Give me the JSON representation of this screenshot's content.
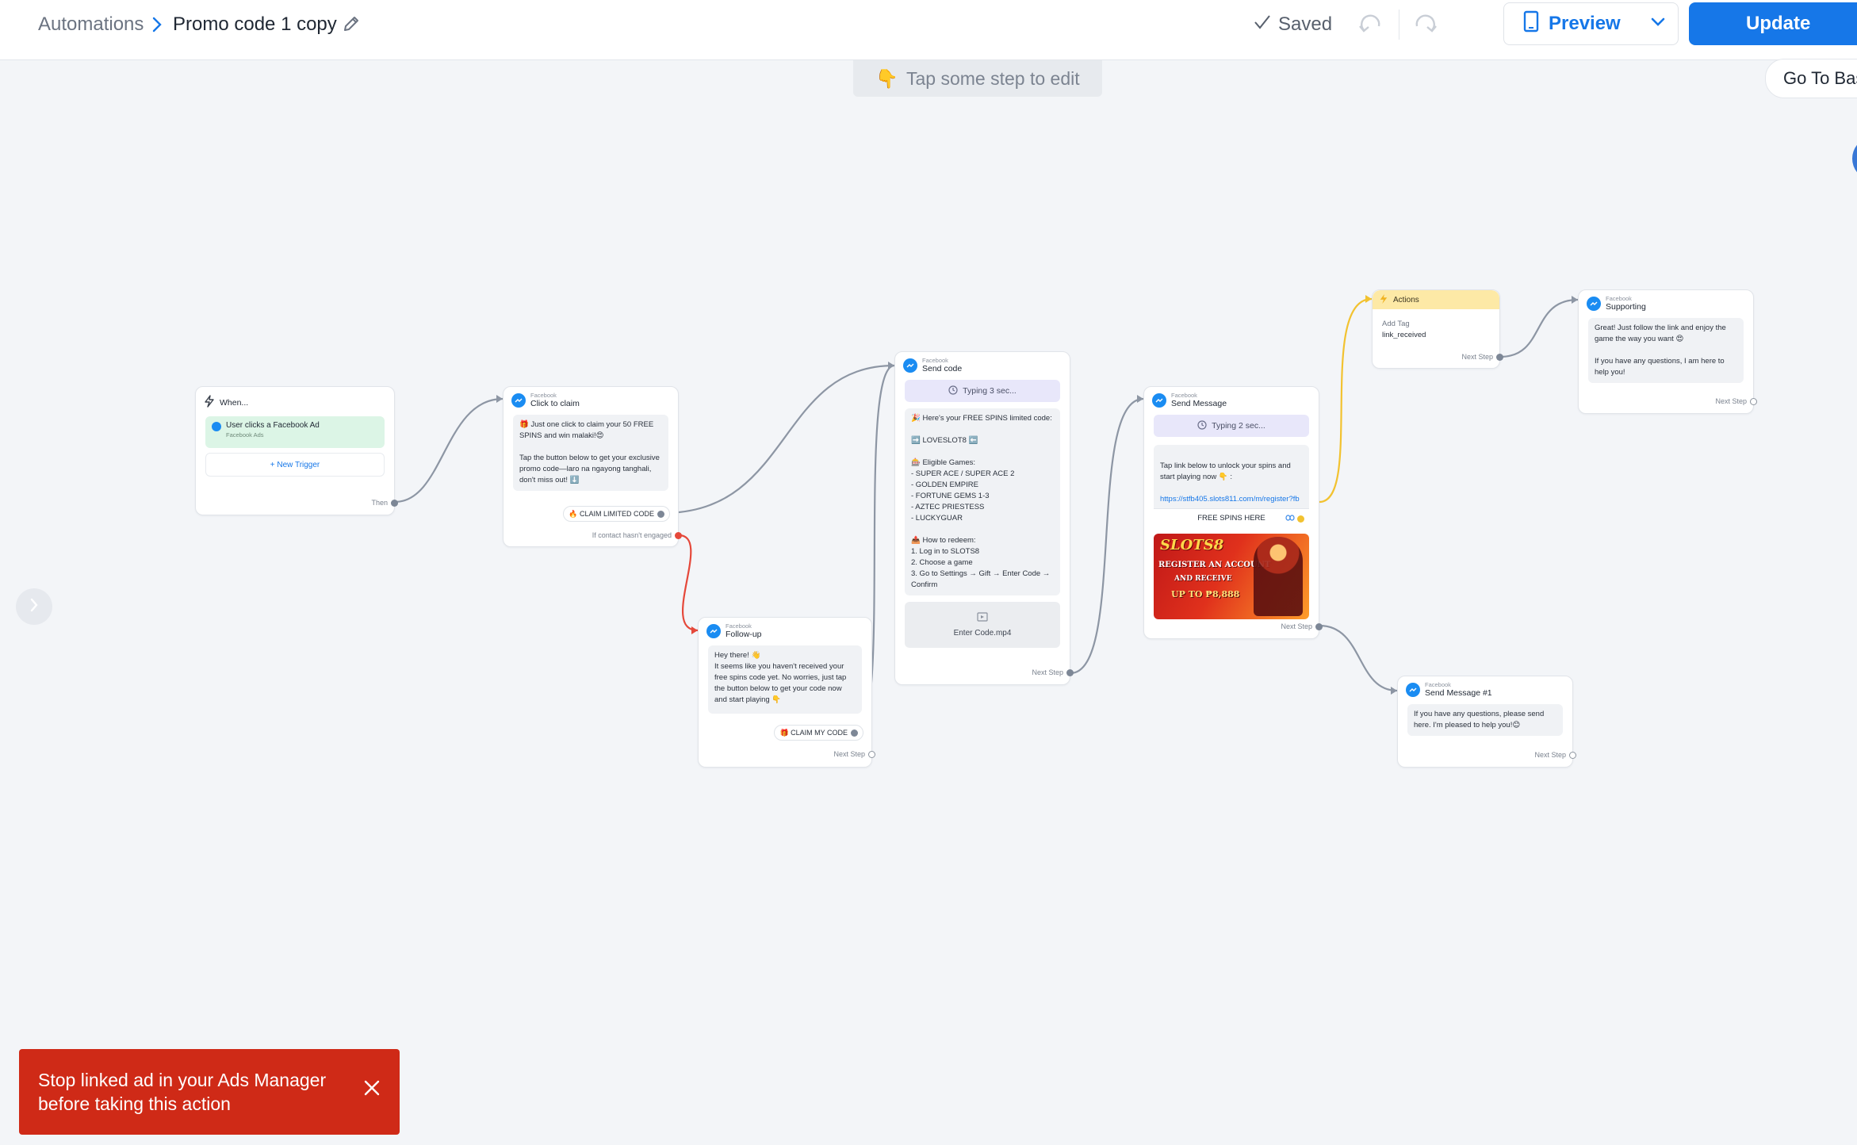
{
  "header": {
    "breadcrumb_root": "Automations",
    "breadcrumb_current": "Promo code 1 copy",
    "saved_label": "Saved",
    "preview_label": "Preview",
    "update_label": "Update"
  },
  "canvas": {
    "hint": "Tap some step to edit",
    "hint_icon": "pointing-down-emoji",
    "go_to_basic_label": "Go To Basic"
  },
  "nodes": {
    "trigger": {
      "title": "When...",
      "trigger_label": "User clicks a Facebook Ad",
      "trigger_source": "Facebook Ads",
      "new_trigger": "+ New Trigger",
      "footer": "Then"
    },
    "click_to_claim": {
      "channel": "Facebook",
      "title": "Click to claim",
      "message": "🎁 Just one click to claim your 50 FREE SPINS and win malaki!😍\n\nTap the button below to get your exclusive promo code—laro na ngayong tanghali, don't miss out! ⬇️",
      "button": "🔥 CLAIM LIMITED CODE",
      "footer": "If contact hasn't engaged"
    },
    "follow_up": {
      "channel": "Facebook",
      "title": "Follow-up",
      "message": "Hey there! 👋\nIt seems like you haven't received your free spins code yet. No worries, just tap the button below to get your code now and start playing 👇",
      "button": "🎁 CLAIM MY CODE",
      "footer": "Next Step"
    },
    "send_code": {
      "channel": "Facebook",
      "title": "Send code",
      "typing": "Typing 3 sec...",
      "message": "🎉 Here's your FREE SPINS limited code:\n\n➡️ LOVESLOT8 ⬅️\n\n🎰 Eligible Games:\n- SUPER ACE / SUPER ACE 2\n- GOLDEN EMPIRE\n- FORTUNE GEMS 1-3\n- AZTEC PRIESTESS\n- LUCKYGUAR\n\n📤 How to redeem:\n1. Log in to SLOTS8\n2. Choose a game\n3. Go to Settings → Gift → Enter Code → Confirm",
      "video": "Enter Code.mp4",
      "footer": "Next Step"
    },
    "send_message": {
      "channel": "Facebook",
      "title": "Send Message",
      "typing": "Typing 2 sec...",
      "message": "Tap link below to unlock your spins and start playing now 👇 :",
      "link": "https://stfb405.slots811.com/m/register?fb",
      "button": "FREE SPINS HERE",
      "banner_brand": "SLOTS8",
      "banner_line1": "REGISTER AN ACCOUNT",
      "banner_line2": "AND RECEIVE",
      "banner_line3": "UP TO ₱8,888",
      "footer": "Next Step"
    },
    "actions": {
      "title": "Actions",
      "label": "Add Tag",
      "value": "link_received",
      "footer": "Next Step"
    },
    "supporting": {
      "channel": "Facebook",
      "title": "Supporting",
      "message": "Great! Just follow the link and enjoy the game the way you want 😍\n\nIf you have any questions, I am here to help you!",
      "footer": "Next Step"
    },
    "send_message_1": {
      "channel": "Facebook",
      "title": "Send Message #1",
      "message": "If you have any questions, please send here. I'm pleased to help you!😊",
      "footer": "Next Step"
    }
  },
  "toast": {
    "message": "Stop linked ad in your Ads Manager before taking this action"
  },
  "colors": {
    "accent": "#1677e8",
    "messenger": "#1a8cf2",
    "toast": "#cf2a17",
    "trigger_bg": "#dcf5e6",
    "actions_bg": "#fde9a6",
    "typing_bg": "#e8e7fa"
  }
}
